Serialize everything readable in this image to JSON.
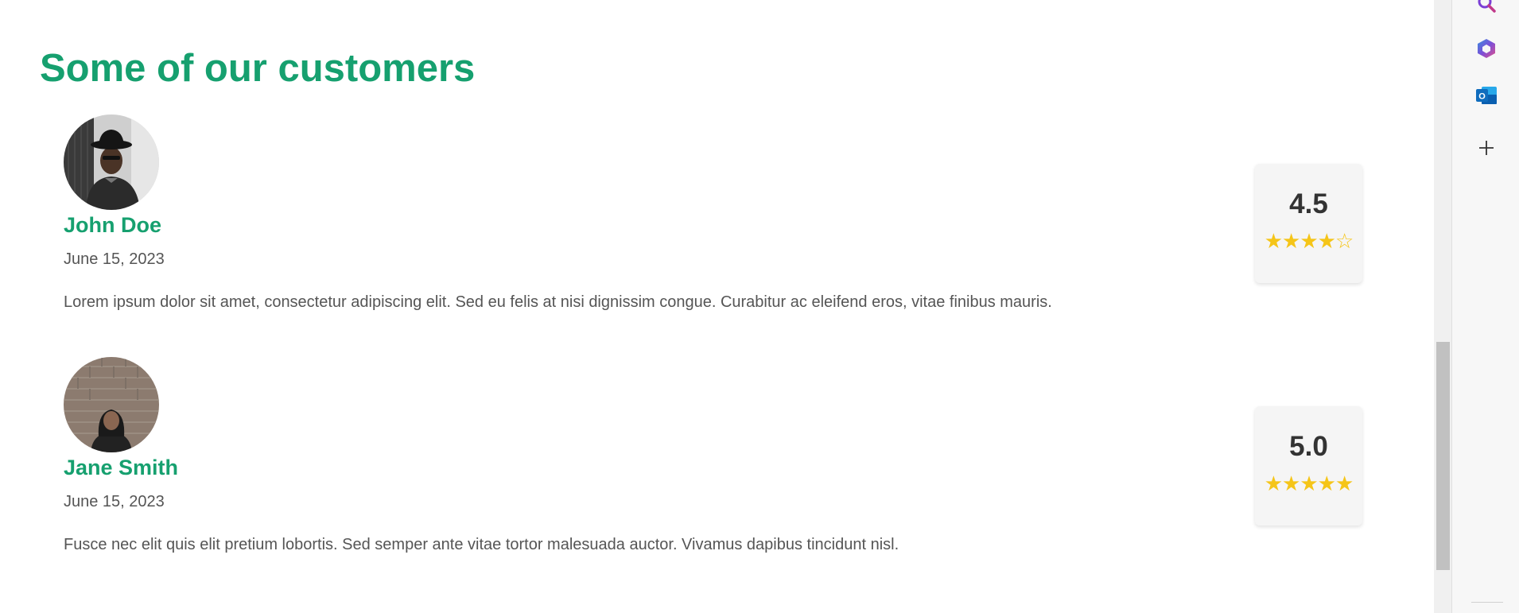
{
  "section": {
    "title": "Some of our customers"
  },
  "reviews": [
    {
      "name": "John Doe",
      "date": "June 15, 2023",
      "text": "Lorem ipsum dolor sit amet, consectetur adipiscing elit. Sed eu felis at nisi dignissim congue. Curabitur ac eleifend eros, vitae finibus mauris.",
      "score": "4.5",
      "stars": [
        "★",
        "★",
        "★",
        "★",
        "☆"
      ]
    },
    {
      "name": "Jane Smith",
      "date": "June 15, 2023",
      "text": "Fusce nec elit quis elit pretium lobortis. Sed semper ante vitae tortor malesuada auctor. Vivamus dapibus tincidunt nisl.",
      "score": "5.0",
      "stars": [
        "★",
        "★",
        "★",
        "★",
        "★"
      ]
    }
  ],
  "side_panel": {
    "icons": [
      "search-icon",
      "copilot-icon",
      "outlook-icon",
      "add-icon"
    ]
  },
  "colors": {
    "accent": "#16a06f",
    "star": "#f5c518",
    "text": "#555555"
  }
}
